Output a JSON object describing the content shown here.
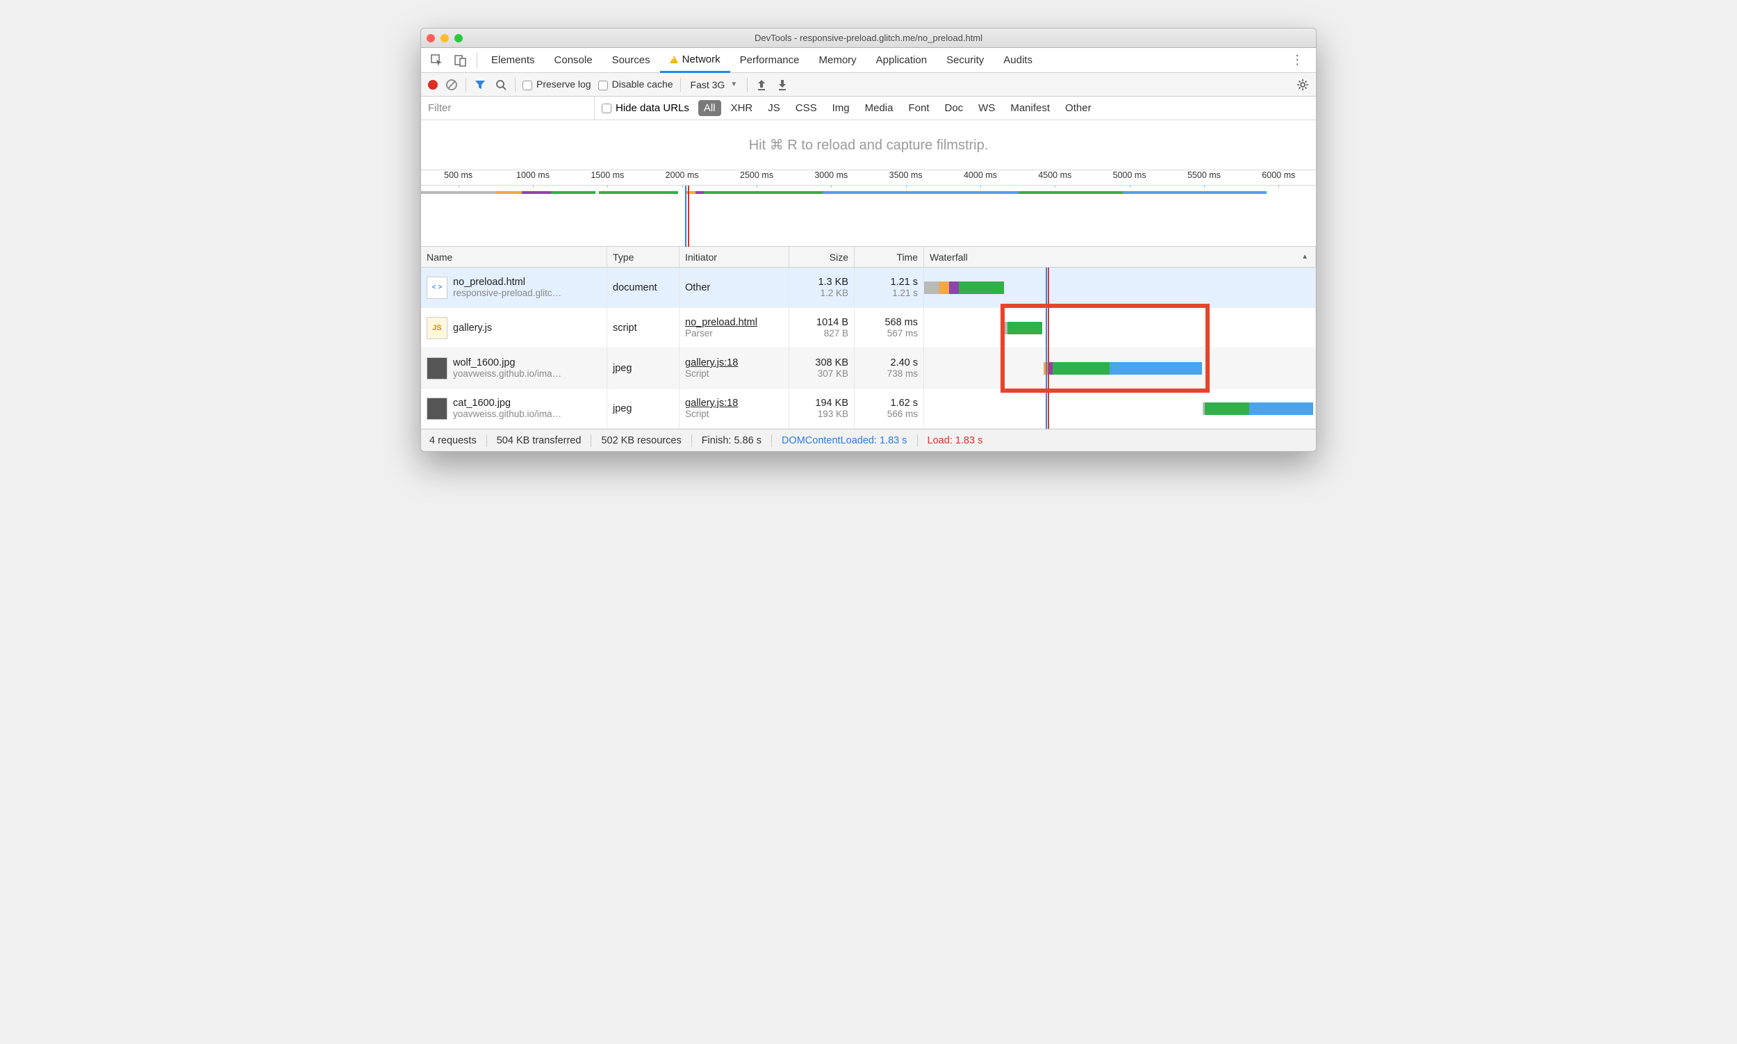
{
  "window": {
    "title": "DevTools - responsive-preload.glitch.me/no_preload.html"
  },
  "tabs": [
    "Elements",
    "Console",
    "Sources",
    "Network",
    "Performance",
    "Memory",
    "Application",
    "Security",
    "Audits"
  ],
  "active_tab": "Network",
  "toolbar": {
    "preserve_log": "Preserve log",
    "disable_cache": "Disable cache",
    "throttle": "Fast 3G"
  },
  "filterbar": {
    "placeholder": "Filter",
    "hide_data_urls": "Hide data URLs",
    "types": [
      "All",
      "XHR",
      "JS",
      "CSS",
      "Img",
      "Media",
      "Font",
      "Doc",
      "WS",
      "Manifest",
      "Other"
    ],
    "active_type": "All"
  },
  "hint": "Hit ⌘ R to reload and capture filmstrip.",
  "overview": {
    "ticks": [
      "500 ms",
      "1000 ms",
      "1500 ms",
      "2000 ms",
      "2500 ms",
      "3000 ms",
      "3500 ms",
      "4000 ms",
      "4500 ms",
      "5000 ms",
      "5500 ms",
      "6000 ms"
    ],
    "range_ms": [
      0,
      6200
    ],
    "dcl_ms": 1830,
    "load_ms": 1830,
    "lanes": [
      [
        {
          "start": 0,
          "end": 520,
          "color": "#b9b9b9"
        },
        {
          "start": 520,
          "end": 700,
          "color": "#f4a742"
        },
        {
          "start": 700,
          "end": 900,
          "color": "#8e44ad"
        },
        {
          "start": 900,
          "end": 1210,
          "color": "#31b04a"
        },
        {
          "start": 1230,
          "end": 1780,
          "color": "#31b04a"
        },
        {
          "start": 1830,
          "end": 1900,
          "color": "#f4a742"
        },
        {
          "start": 1900,
          "end": 1960,
          "color": "#8e44ad"
        },
        {
          "start": 1960,
          "end": 2780,
          "color": "#31b04a"
        },
        {
          "start": 2780,
          "end": 4140,
          "color": "#4aa3ec"
        },
        {
          "start": 4140,
          "end": 4860,
          "color": "#31b04a"
        },
        {
          "start": 4860,
          "end": 5860,
          "color": "#4aa3ec"
        }
      ]
    ]
  },
  "columns": {
    "name": "Name",
    "type": "Type",
    "initiator": "Initiator",
    "size": "Size",
    "time": "Time",
    "waterfall": "Waterfall"
  },
  "wf_range_ms": [
    0,
    5900
  ],
  "rows": [
    {
      "icon": "html",
      "name": "no_preload.html",
      "name_sub": "responsive-preload.glitc…",
      "type": "document",
      "initiator": "Other",
      "initiator_link": false,
      "initiator_sub": "",
      "size": "1.3 KB",
      "size_sub": "1.2 KB",
      "time": "1.21 s",
      "time_sub": "1.21 s",
      "selected": true,
      "wf": [
        {
          "start": 0,
          "end": 230,
          "color": "#b9b9b9"
        },
        {
          "start": 230,
          "end": 380,
          "color": "#f4a742"
        },
        {
          "start": 380,
          "end": 520,
          "color": "#8e44ad"
        },
        {
          "start": 520,
          "end": 1210,
          "color": "#31b04a"
        }
      ]
    },
    {
      "icon": "js",
      "name": "gallery.js",
      "name_sub": "",
      "type": "script",
      "initiator": "no_preload.html",
      "initiator_link": true,
      "initiator_sub": "Parser",
      "size": "1014 B",
      "size_sub": "827 B",
      "time": "568 ms",
      "time_sub": "567 ms",
      "wf": [
        {
          "start": 1210,
          "end": 1260,
          "color": "#b9b9b9"
        },
        {
          "start": 1260,
          "end": 1780,
          "color": "#31b04a"
        }
      ]
    },
    {
      "icon": "img",
      "name": "wolf_1600.jpg",
      "name_sub": "yoavweiss.github.io/ima…",
      "type": "jpeg",
      "initiator": "gallery.js:18",
      "initiator_link": true,
      "initiator_sub": "Script",
      "size": "308 KB",
      "size_sub": "307 KB",
      "time": "2.40 s",
      "time_sub": "738 ms",
      "wf": [
        {
          "start": 1800,
          "end": 1870,
          "color": "#f4a742"
        },
        {
          "start": 1870,
          "end": 1940,
          "color": "#8e44ad"
        },
        {
          "start": 1940,
          "end": 2800,
          "color": "#31b04a"
        },
        {
          "start": 2800,
          "end": 4190,
          "color": "#4aa3ec"
        }
      ]
    },
    {
      "icon": "img",
      "name": "cat_1600.jpg",
      "name_sub": "yoavweiss.github.io/ima…",
      "type": "jpeg",
      "initiator": "gallery.js:18",
      "initiator_link": true,
      "initiator_sub": "Script",
      "size": "194 KB",
      "size_sub": "193 KB",
      "time": "1.62 s",
      "time_sub": "566 ms",
      "wf": [
        {
          "start": 4200,
          "end": 4230,
          "color": "#b9b9b9"
        },
        {
          "start": 4230,
          "end": 4900,
          "color": "#31b04a"
        },
        {
          "start": 4900,
          "end": 5870,
          "color": "#4aa3ec"
        }
      ]
    }
  ],
  "highlight_rows": [
    1,
    2
  ],
  "status": {
    "requests": "4 requests",
    "transferred": "504 KB transferred",
    "resources": "502 KB resources",
    "finish": "Finish: 5.86 s",
    "dcl": "DOMContentLoaded: 1.83 s",
    "load": "Load: 1.83 s"
  }
}
